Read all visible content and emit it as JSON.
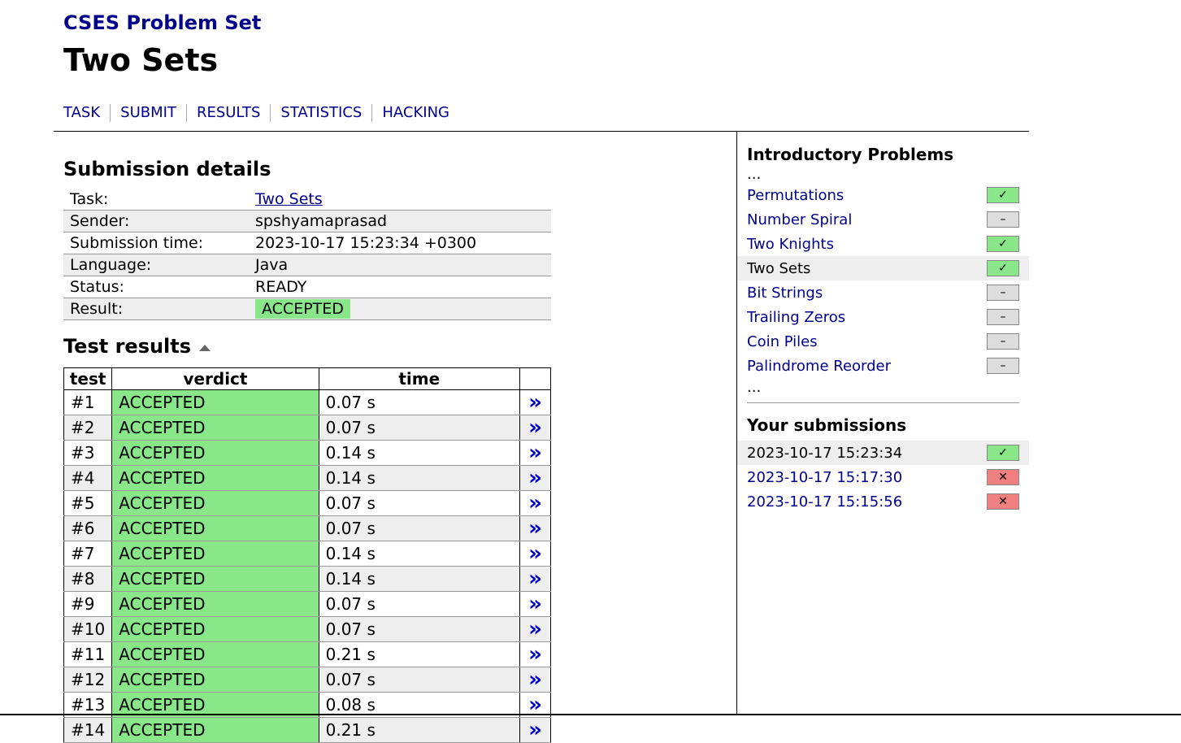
{
  "header": {
    "site": "CSES Problem Set",
    "title": "Two Sets"
  },
  "nav": [
    "TASK",
    "SUBMIT",
    "RESULTS",
    "STATISTICS",
    "HACKING"
  ],
  "details": {
    "heading": "Submission details",
    "rows": [
      {
        "key": "Task:",
        "value": "Two Sets"
      },
      {
        "key": "Sender:",
        "value": "spshyamaprasad"
      },
      {
        "key": "Submission time:",
        "value": "2023-10-17 15:23:34 +0300"
      },
      {
        "key": "Language:",
        "value": "Java"
      },
      {
        "key": "Status:",
        "value": "READY"
      },
      {
        "key": "Result:",
        "value": "ACCEPTED"
      }
    ]
  },
  "tests": {
    "heading": "Test results",
    "columns": [
      "test",
      "verdict",
      "time"
    ],
    "link_glyph": "»",
    "rows": [
      {
        "test": "#1",
        "verdict": "ACCEPTED",
        "time": "0.07 s"
      },
      {
        "test": "#2",
        "verdict": "ACCEPTED",
        "time": "0.07 s"
      },
      {
        "test": "#3",
        "verdict": "ACCEPTED",
        "time": "0.14 s"
      },
      {
        "test": "#4",
        "verdict": "ACCEPTED",
        "time": "0.14 s"
      },
      {
        "test": "#5",
        "verdict": "ACCEPTED",
        "time": "0.07 s"
      },
      {
        "test": "#6",
        "verdict": "ACCEPTED",
        "time": "0.07 s"
      },
      {
        "test": "#7",
        "verdict": "ACCEPTED",
        "time": "0.14 s"
      },
      {
        "test": "#8",
        "verdict": "ACCEPTED",
        "time": "0.14 s"
      },
      {
        "test": "#9",
        "verdict": "ACCEPTED",
        "time": "0.07 s"
      },
      {
        "test": "#10",
        "verdict": "ACCEPTED",
        "time": "0.07 s"
      },
      {
        "test": "#11",
        "verdict": "ACCEPTED",
        "time": "0.21 s"
      },
      {
        "test": "#12",
        "verdict": "ACCEPTED",
        "time": "0.07 s"
      },
      {
        "test": "#13",
        "verdict": "ACCEPTED",
        "time": "0.08 s"
      },
      {
        "test": "#14",
        "verdict": "ACCEPTED",
        "time": "0.21 s"
      }
    ]
  },
  "sidebar": {
    "section_title": "Introductory Problems",
    "ellipsis": "...",
    "problems": [
      {
        "name": "Permutations",
        "status": "ok",
        "current": false
      },
      {
        "name": "Number Spiral",
        "status": "na",
        "current": false
      },
      {
        "name": "Two Knights",
        "status": "ok",
        "current": false
      },
      {
        "name": "Two Sets",
        "status": "ok",
        "current": true
      },
      {
        "name": "Bit Strings",
        "status": "na",
        "current": false
      },
      {
        "name": "Trailing Zeros",
        "status": "na",
        "current": false
      },
      {
        "name": "Coin Piles",
        "status": "na",
        "current": false
      },
      {
        "name": "Palindrome Reorder",
        "status": "na",
        "current": false
      }
    ],
    "submissions_title": "Your submissions",
    "submissions": [
      {
        "time": "2023-10-17 15:23:34",
        "status": "ok",
        "current": true
      },
      {
        "time": "2023-10-17 15:17:30",
        "status": "bad",
        "current": false
      },
      {
        "time": "2023-10-17 15:15:56",
        "status": "bad",
        "current": false
      }
    ]
  },
  "icons": {
    "ok": "✓",
    "na": "–",
    "bad": "✕"
  },
  "colors": {
    "link": "#00008b",
    "accepted": "#89e689",
    "fail": "#f08080",
    "neutral": "#dddddd"
  }
}
